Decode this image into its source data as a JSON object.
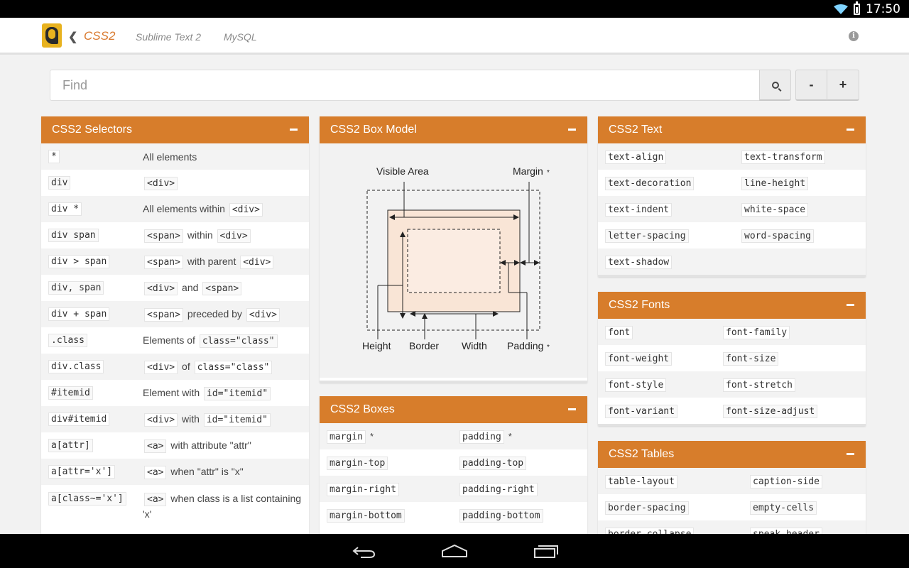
{
  "status": {
    "time": "17:50"
  },
  "actionbar": {
    "tabs": [
      {
        "label": "CSS2",
        "active": true
      },
      {
        "label": "Sublime Text 2",
        "active": false
      },
      {
        "label": "MySQL",
        "active": false
      }
    ]
  },
  "search": {
    "placeholder": "Find",
    "minus": "-",
    "plus": "+"
  },
  "colors": {
    "accent": "#d77d2b",
    "header_text": "#ffffff"
  },
  "selectors": {
    "title": "CSS2 Selectors",
    "rows": [
      {
        "sel": "*",
        "desc": [
          {
            "t": "All elements"
          }
        ]
      },
      {
        "sel": "div",
        "desc": [
          {
            "c": "<div>"
          }
        ]
      },
      {
        "sel": "div *",
        "desc": [
          {
            "t": "All elements within"
          },
          {
            "c": "<div>"
          }
        ]
      },
      {
        "sel": "div span",
        "desc": [
          {
            "c": "<span>"
          },
          {
            "t": "within"
          },
          {
            "c": "<div>"
          }
        ]
      },
      {
        "sel": "div > span",
        "desc": [
          {
            "c": "<span>"
          },
          {
            "t": "with parent"
          },
          {
            "c": "<div>"
          }
        ]
      },
      {
        "sel": "div, span",
        "desc": [
          {
            "c": "<div>"
          },
          {
            "t": "and"
          },
          {
            "c": "<span>"
          }
        ]
      },
      {
        "sel": "div + span",
        "desc": [
          {
            "c": "<span>"
          },
          {
            "t": "preceded by"
          },
          {
            "c": "<div>"
          }
        ]
      },
      {
        "sel": ".class",
        "desc": [
          {
            "t": "Elements of"
          },
          {
            "c": "class=\"class\""
          }
        ]
      },
      {
        "sel": "div.class",
        "desc": [
          {
            "c": "<div>"
          },
          {
            "t": "of"
          },
          {
            "c": "class=\"class\""
          }
        ]
      },
      {
        "sel": "#itemid",
        "desc": [
          {
            "t": "Element with"
          },
          {
            "c": "id=\"itemid\""
          }
        ]
      },
      {
        "sel": "div#itemid",
        "desc": [
          {
            "c": "<div>"
          },
          {
            "t": "with"
          },
          {
            "c": "id=\"itemid\""
          }
        ]
      },
      {
        "sel": "a[attr]",
        "desc": [
          {
            "c": "<a>"
          },
          {
            "t": "with attribute \"attr\""
          }
        ]
      },
      {
        "sel": "a[attr='x']",
        "desc": [
          {
            "c": "<a>"
          },
          {
            "t": "when \"attr\" is \"x\""
          }
        ]
      },
      {
        "sel": "a[class~='x']",
        "desc": [
          {
            "c": "<a>"
          },
          {
            "t": "when class is a list containing 'x'"
          }
        ],
        "tall": true
      }
    ]
  },
  "box_model": {
    "title": "CSS2 Box Model",
    "labels": {
      "visible_area": "Visible Area",
      "margin": "Margin",
      "height": "Height",
      "border": "Border",
      "width": "Width",
      "padding": "Padding",
      "star": "*"
    }
  },
  "boxes": {
    "title": "CSS2 Boxes",
    "rows": [
      {
        "a": "margin",
        "a_star": "*",
        "b": "padding",
        "b_star": "*"
      },
      {
        "a": "margin-top",
        "b": "padding-top"
      },
      {
        "a": "margin-right",
        "b": "padding-right"
      },
      {
        "a": "margin-bottom",
        "b": "padding-bottom"
      }
    ]
  },
  "text": {
    "title": "CSS2 Text",
    "rows": [
      {
        "a": "text-align",
        "b": "text-transform"
      },
      {
        "a": "text-decoration",
        "b": "line-height"
      },
      {
        "a": "text-indent",
        "b": "white-space"
      },
      {
        "a": "letter-spacing",
        "b": "word-spacing"
      },
      {
        "a": "text-shadow",
        "b": ""
      }
    ]
  },
  "fonts": {
    "title": "CSS2 Fonts",
    "rows": [
      {
        "a": "font",
        "b": "font-family"
      },
      {
        "a": "font-weight",
        "b": "font-size"
      },
      {
        "a": "font-style",
        "b": "font-stretch"
      },
      {
        "a": "font-variant",
        "b": "font-size-adjust"
      }
    ]
  },
  "tables": {
    "title": "CSS2 Tables",
    "rows": [
      {
        "a": "table-layout",
        "b": "caption-side"
      },
      {
        "a": "border-spacing",
        "b": "empty-cells"
      },
      {
        "a": "border-collapse",
        "b": "speak-header"
      }
    ]
  }
}
